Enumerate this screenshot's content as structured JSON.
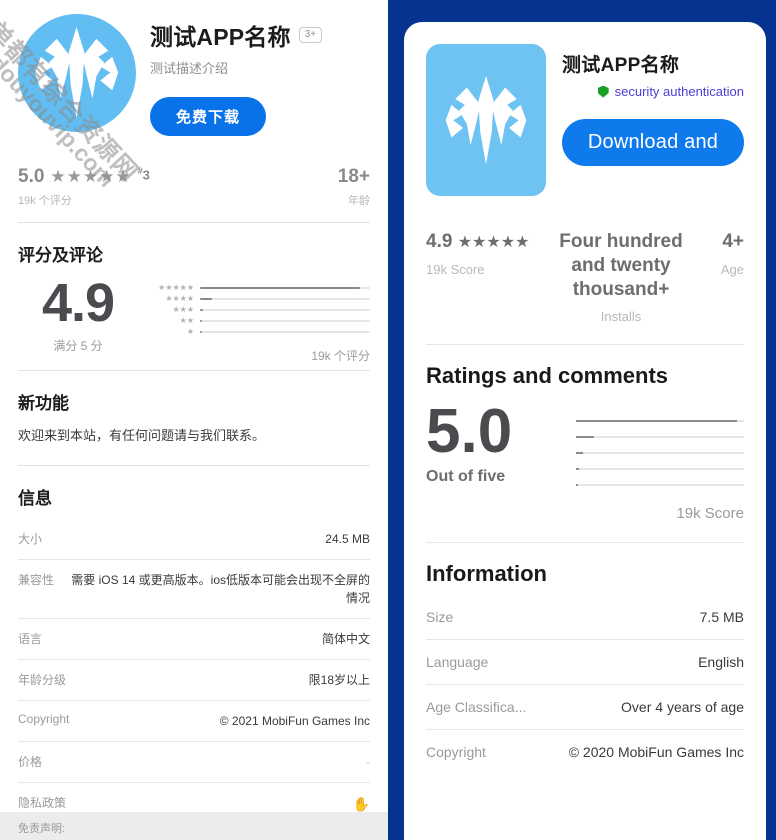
{
  "left": {
    "app_icon_name": "app-logo-emblem",
    "title": "测试APP名称",
    "age_badge": "3+",
    "subtitle": "测试描述介绍",
    "download_label": "免费下载",
    "stats": {
      "rating_value": "5.0",
      "rating_stars": "★★★★★",
      "rating_caption": "19k 个评分",
      "rank_prefix": "#",
      "rank_value": "3",
      "age_value": "18+",
      "age_caption": "年龄"
    },
    "ratings_section": {
      "heading": "评分及评论",
      "score": "4.9",
      "score_caption": "满分 5 分",
      "total_caption": "19k 个评分",
      "bars": [
        {
          "stars": "★★★★★",
          "percent": 94
        },
        {
          "stars": "★★★★",
          "percent": 7
        },
        {
          "stars": "★★★",
          "percent": 2
        },
        {
          "stars": "★★",
          "percent": 1
        },
        {
          "stars": "★",
          "percent": 1
        }
      ]
    },
    "whats_new": {
      "heading": "新功能",
      "body": "欢迎来到本站，有任何问题请与我们联系。"
    },
    "information": {
      "heading": "信息",
      "rows": [
        {
          "key": "大小",
          "value": "24.5 MB",
          "muted": false
        },
        {
          "key": "兼容性",
          "value": "需要 iOS 14 或更高版本。ios低版本可能会出现不全屏的情况",
          "muted": false
        },
        {
          "key": "语言",
          "value": "简体中文",
          "muted": false
        },
        {
          "key": "年龄分级",
          "value": "限18岁以上",
          "muted": false
        },
        {
          "key": "Copyright",
          "value": "© 2021 MobiFun Games Inc",
          "muted": false
        },
        {
          "key": "价格",
          "value": "-",
          "muted": true
        },
        {
          "key": "隐私政策",
          "value": "✋",
          "muted": false
        }
      ]
    },
    "disclaimer": "免责声明:",
    "watermark": {
      "cn": "单都有综合资源网",
      "en": "douyouvip.com"
    }
  },
  "right": {
    "background_color": "#06338f",
    "app_icon_name": "app-logo-emblem",
    "title": "测试APP名称",
    "verified_text": "security authentication",
    "download_label": "Download and",
    "stats": {
      "rating_value": "4.9",
      "rating_stars": "★★★★★",
      "rating_caption": "19k Score",
      "installs_value": "Four hundred and twenty thousand+",
      "installs_caption": "Installs",
      "age_value": "4+",
      "age_caption": "Age"
    },
    "ratings_section": {
      "heading": "Ratings and comments",
      "score": "5.0",
      "score_caption": "Out of five",
      "total_caption": "19k Score",
      "bars": [
        {
          "percent": 96
        },
        {
          "percent": 11
        },
        {
          "percent": 4
        },
        {
          "percent": 2
        },
        {
          "percent": 1
        }
      ]
    },
    "information": {
      "heading": "Information",
      "rows": [
        {
          "key": "Size",
          "value": "7.5 MB"
        },
        {
          "key": "Language",
          "value": "English"
        },
        {
          "key": "Age Classifica...",
          "value": "Over 4 years of age"
        },
        {
          "key": "Copyright",
          "value": "© 2020 MobiFun Games Inc"
        }
      ]
    }
  },
  "colors": {
    "left_button": "#0a72e8",
    "right_button": "#0f7aec",
    "right_bg": "#06338f",
    "icon_bg": "#6fc3f2",
    "verified": "#4b3fd6"
  }
}
